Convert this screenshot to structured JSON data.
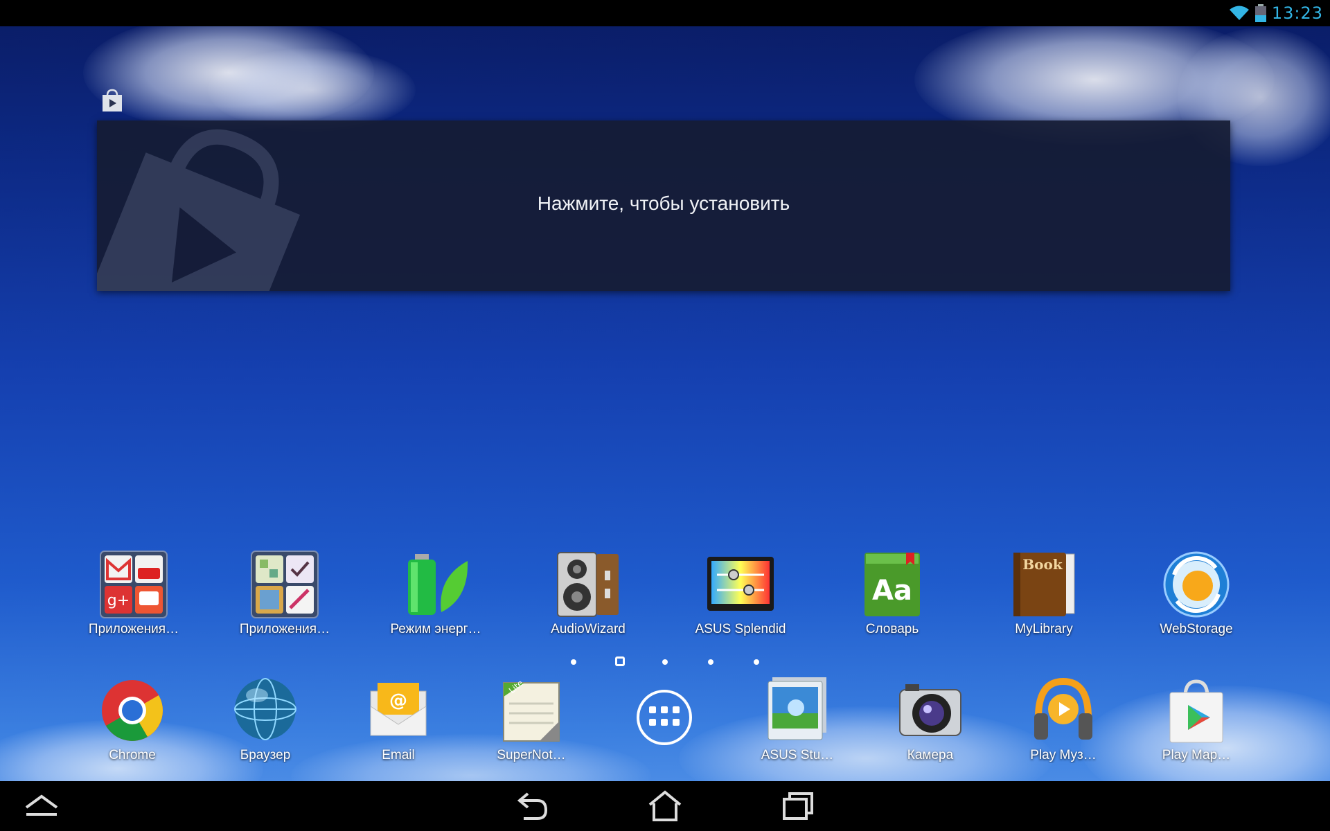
{
  "status_bar": {
    "time": "13:23",
    "wifi_icon": "wifi-icon",
    "battery_icon": "battery-icon"
  },
  "widget": {
    "message": "Нажмите, чтобы установить",
    "icon": "play-store-icon"
  },
  "page_indicator": {
    "pages": 5,
    "current": 2
  },
  "home_row": [
    {
      "label": "Приложения…",
      "icon": "google-apps-folder-icon"
    },
    {
      "label": "Приложения…",
      "icon": "apps-folder-icon"
    },
    {
      "label": "Режим энерг…",
      "icon": "power-saver-icon"
    },
    {
      "label": "AudioWizard",
      "icon": "speaker-icon"
    },
    {
      "label": "ASUS Splendid",
      "icon": "splendid-icon"
    },
    {
      "label": "Словарь",
      "icon": "dictionary-icon"
    },
    {
      "label": "MyLibrary",
      "icon": "book-icon"
    },
    {
      "label": "WebStorage",
      "icon": "webstorage-icon"
    }
  ],
  "dock": [
    {
      "label": "Chrome",
      "icon": "chrome-icon"
    },
    {
      "label": "Браузер",
      "icon": "browser-globe-icon"
    },
    {
      "label": "Email",
      "icon": "email-icon"
    },
    {
      "label": "SuperNot…",
      "icon": "supernote-icon"
    },
    {
      "label": "",
      "icon": "app-drawer-icon"
    },
    {
      "label": "ASUS Stu…",
      "icon": "asus-studio-icon"
    },
    {
      "label": "Камера",
      "icon": "camera-icon"
    },
    {
      "label": "Play Муз…",
      "icon": "play-music-icon"
    },
    {
      "label": "Play Мар…",
      "icon": "play-market-icon"
    }
  ],
  "nav_bar": {
    "buttons": [
      "collapse-icon",
      "back-icon",
      "home-icon",
      "recents-icon"
    ]
  }
}
